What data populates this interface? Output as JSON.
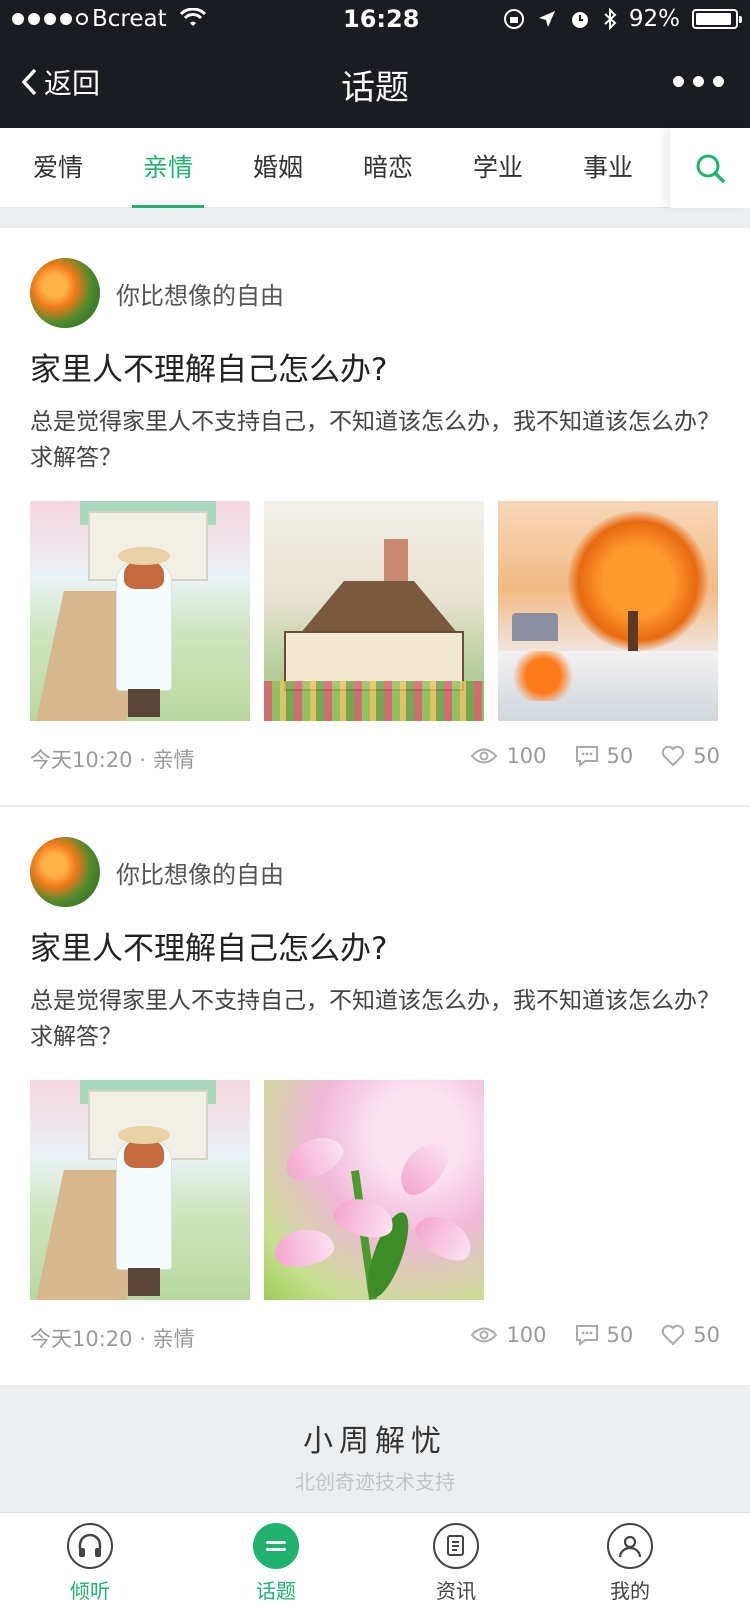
{
  "status_bar": {
    "carrier": "Bcreat",
    "time": "16:28",
    "battery": "92%",
    "signal_bars": 4
  },
  "nav": {
    "back_label": "返回",
    "title": "话题"
  },
  "tabs": [
    {
      "label": "爱情",
      "active": false
    },
    {
      "label": "亲情",
      "active": true
    },
    {
      "label": "婚姻",
      "active": false
    },
    {
      "label": "暗恋",
      "active": false
    },
    {
      "label": "学业",
      "active": false
    },
    {
      "label": "事业",
      "active": false
    }
  ],
  "posts": [
    {
      "author": "你比想像的自由",
      "title": "家里人不理解自己怎么办?",
      "body": "总是觉得家里人不支持自己，不知道该怎么办，我不知道该怎么办？求解答？",
      "images": [
        "watercolor-girl-house",
        "watercolor-cottage",
        "watercolor-autumn-snow"
      ],
      "time": "今天10:20",
      "category": "亲情",
      "views": "100",
      "comments": "50",
      "likes": "50"
    },
    {
      "author": "你比想像的自由",
      "title": "家里人不理解自己怎么办?",
      "body": "总是觉得家里人不支持自己，不知道该怎么办，我不知道该怎么办？求解答？",
      "images": [
        "watercolor-girl-house",
        "pink-lily-flowers"
      ],
      "time": "今天10:20",
      "category": "亲情",
      "views": "100",
      "comments": "50",
      "likes": "50"
    }
  ],
  "footer": {
    "brand": "小周解忧",
    "subtitle": "北创奇迹技术支持"
  },
  "tabbar": [
    {
      "label": "倾听",
      "icon": "headphones-icon",
      "active": false,
      "label_green": true
    },
    {
      "label": "话题",
      "icon": "chat-icon",
      "active": true,
      "label_green": true
    },
    {
      "label": "资讯",
      "icon": "news-icon",
      "active": false,
      "label_green": false
    },
    {
      "label": "我的",
      "icon": "profile-icon",
      "active": false,
      "label_green": false
    }
  ],
  "colors": {
    "accent": "#20b36f",
    "nav_bg": "#1b1b22",
    "page_bg": "#eceef0"
  }
}
